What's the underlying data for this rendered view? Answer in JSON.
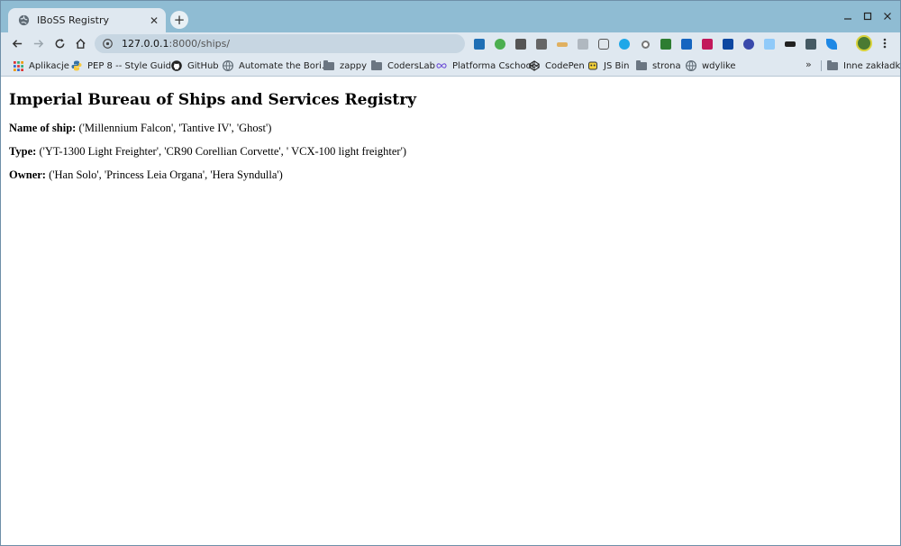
{
  "browser": {
    "tab": {
      "title": "IBoSS Registry"
    },
    "url": {
      "host": "127.0.0.1",
      "rest": ":8000/ships/"
    },
    "bookmarks": [
      {
        "label": "Aplikacje",
        "icon": "apps-grid-icon"
      },
      {
        "label": "PEP 8 -- Style Guid...",
        "icon": "python-icon"
      },
      {
        "label": "GitHub",
        "icon": "github-icon"
      },
      {
        "label": "Automate the Bori...",
        "icon": "globe-icon"
      },
      {
        "label": "zappy",
        "icon": "folder-icon"
      },
      {
        "label": "CodersLab",
        "icon": "folder-icon"
      },
      {
        "label": "Platforma Cschool",
        "icon": "infinity-icon"
      },
      {
        "label": "CodePen",
        "icon": "codepen-icon"
      },
      {
        "label": "JS Bin",
        "icon": "jsbin-icon"
      },
      {
        "label": "strona",
        "icon": "folder-icon"
      },
      {
        "label": "wdylike",
        "icon": "globe-icon"
      }
    ],
    "bookmarks_more": "»",
    "other_bookmarks": "Inne zakładki"
  },
  "page": {
    "heading": "Imperial Bureau of Ships and Services Registry",
    "rows": [
      {
        "label": "Name of ship:",
        "value": " ('Millennium Falcon', 'Tantive IV', 'Ghost')"
      },
      {
        "label": "Type:",
        "value": " ('YT-1300 Light Freighter', 'CR90 Corellian Corvette', ' VCX-100 light freighter')"
      },
      {
        "label": "Owner:",
        "value": " ('Han Solo', 'Princess Leia Organa', 'Hera Syndulla')"
      }
    ]
  },
  "colors": {
    "tab_strip": "#8fbcd3",
    "toolbar": "#dfe8f0",
    "omnibox": "#c7d6e2"
  }
}
